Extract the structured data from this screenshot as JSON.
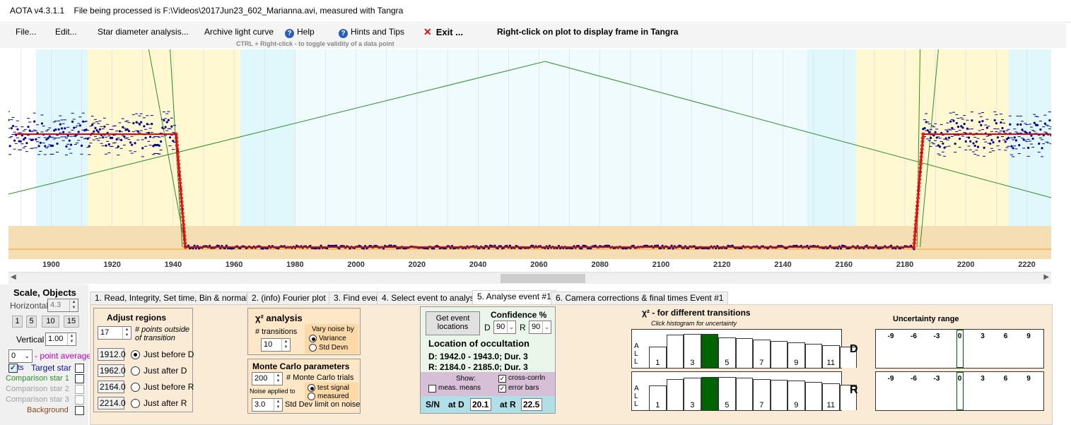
{
  "window": {
    "title": "AOTA v4.3.1.1    File being processed is F:\\Videos\\2017Jun23_602_Marianna.avi, measured with Tangra"
  },
  "menu": {
    "file": "File...",
    "edit": "Edit...",
    "star_diameter": "Star diameter analysis...",
    "archive": "Archive light curve",
    "help": "Help",
    "hints": "Hints and Tips",
    "exit": "Exit ...",
    "right_click_hint": "Right-click on plot to display frame in Tangra",
    "ctrl_hint": "CTRL + Right-click   -  to toggle validity of a data point"
  },
  "plot": {
    "x_ticks": [
      "1900",
      "1920",
      "1940",
      "1960",
      "1980",
      "2000",
      "2020",
      "2040",
      "2060",
      "2080",
      "2100",
      "2120",
      "2140",
      "2160",
      "2180",
      "2200",
      "2220"
    ],
    "x_range": [
      1886,
      2228
    ],
    "colors": {
      "yellow_zone": "#fff8d0",
      "cyan_zone": "#e0f7fb",
      "base_zone": "#f5deb3",
      "model": "#e00000",
      "points": "#00008b",
      "chi_line": "#2e8b2e"
    }
  },
  "left_panel": {
    "scale_objects": "Scale,  Objects",
    "horizontal": "Horizontal",
    "horizontal_value": "4.3",
    "scale_buttons": [
      "1",
      "5",
      "10",
      "15"
    ],
    "vertical": "Vertical",
    "vertical_value": "1.00",
    "avg_value": "0",
    "avg_label": "- point average",
    "target": "Target star",
    "target_prefix": "ts",
    "comp1": "Comparison star 1",
    "comp2": "Comparison star 2",
    "comp3": "Comparison star 3",
    "background": "Background"
  },
  "tabs": [
    "1. Read, Integrity, Set time, Bin & normalise",
    "2. (info)  Fourier plot",
    "3. Find events",
    "4. Select event to analyse",
    "5. Analyse event #1",
    "6. Camera corrections & final times Event #1"
  ],
  "adjust": {
    "title": "Adjust regions",
    "points_value": "17",
    "points_label": "# points outside of transition",
    "rows": [
      {
        "value": "1912.0",
        "label": "Just before D",
        "selected": true
      },
      {
        "value": "1962.0",
        "label": "Just after D",
        "selected": false
      },
      {
        "value": "2164.0",
        "label": "Just before R",
        "selected": false
      },
      {
        "value": "2214.0",
        "label": "Just after R",
        "selected": false
      }
    ]
  },
  "chi_analysis": {
    "title": "χ² analysis",
    "transitions_label": "# transitions",
    "transitions_value": "10",
    "vary_label": "Vary noise by",
    "variance": "Variance",
    "std_devn": "Std Devn"
  },
  "monte_carlo": {
    "title": "Monte Carlo parameters",
    "trials_value": "200",
    "trials_label": "# Monte Carlo trials",
    "noise_applied": "Noise applied to",
    "test_signal": "test signal",
    "measured": "measured",
    "std_value": "3.0",
    "std_label": "Std Dev limit on noise"
  },
  "event": {
    "get_button": "Get event locations",
    "confidence": "Confidence %",
    "d_label": "D",
    "d_value": "90",
    "r_label": "R",
    "r_value": "90",
    "location_title": "Location of occultation",
    "d_line": "D: 1942.0 - 1943.0; Dur. 3",
    "r_line": "R: 2184.0 - 2185.0; Dur. 3",
    "show": "Show:",
    "meas_means": "meas. means",
    "cross_corr": "cross-corrln",
    "error_bars": "error bars",
    "sn": "S/N",
    "at_d": "at D",
    "sn_d": "20.1",
    "at_r": "at R",
    "sn_r": "22.5"
  },
  "chi_transitions": {
    "title": "χ² - for different transitions",
    "subtitle": "Click histogram for uncertainty",
    "side_label": [
      "A",
      "L",
      "L"
    ],
    "x_labels": [
      "1",
      "3",
      "5",
      "7",
      "9",
      "11"
    ],
    "d_label": "D",
    "r_label": "R",
    "d_values": [
      0.62,
      0.98,
      1.0,
      1.0,
      0.9,
      0.88,
      0.84,
      0.8,
      0.75,
      0.71,
      0.67,
      0.63
    ],
    "r_values": [
      0.72,
      0.92,
      0.95,
      0.98,
      0.97,
      0.95,
      0.92,
      0.9,
      0.88,
      0.84,
      0.8,
      0.75
    ],
    "selected_index": 3
  },
  "uncertainty": {
    "title": "Uncertainty range",
    "ticks": [
      "-9",
      "-6",
      "-3",
      "0",
      "3",
      "6",
      "9"
    ]
  }
}
